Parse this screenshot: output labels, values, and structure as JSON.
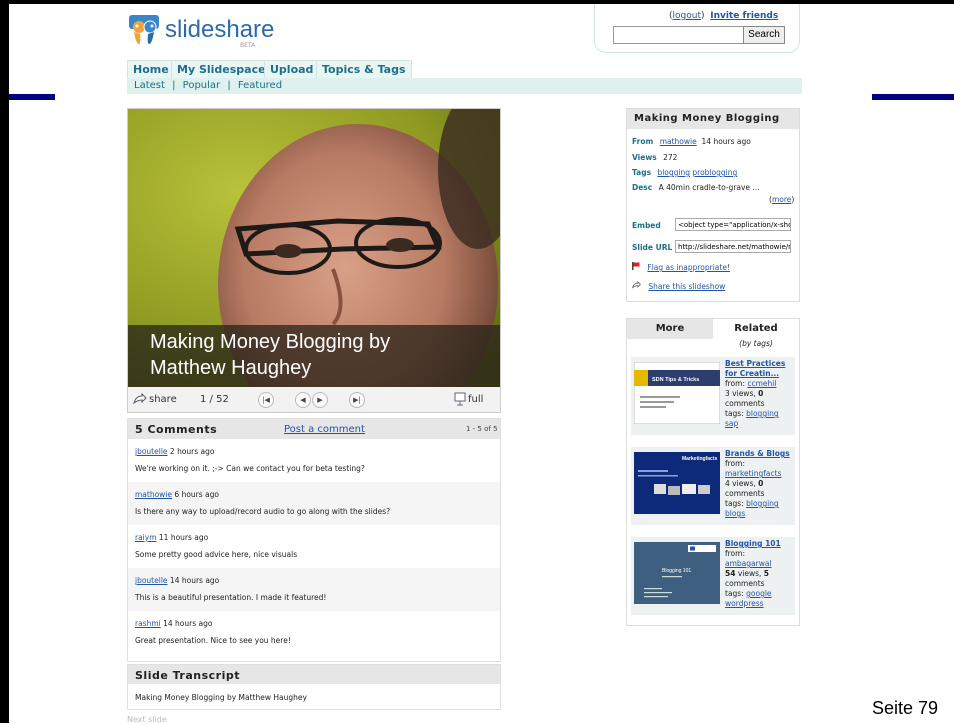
{
  "site": {
    "brand": "slideshare",
    "beta": "BETA",
    "colors": {
      "accent": "#1d6f8a",
      "link": "#2255aa",
      "nav_bg": "#eaf6f4",
      "frame_bar": "#000080"
    }
  },
  "header": {
    "logout": "logout",
    "invite": "Invite friends",
    "search_button": "Search",
    "search_value": ""
  },
  "nav": {
    "tabs": [
      "Home",
      "My Slidespace",
      "Upload",
      "Topics & Tags"
    ],
    "subnav": [
      "Latest",
      "Popular",
      "Featured"
    ]
  },
  "player": {
    "slide_title_line1": "Making Money Blogging by",
    "slide_title_line2": "Matthew Haughey",
    "share": "share",
    "counter": "1 / 52",
    "full": "full",
    "icons": [
      "share-icon",
      "first-slide-icon",
      "prev-slide-icon",
      "next-slide-icon",
      "last-slide-icon",
      "fullscreen-icon"
    ]
  },
  "comments": {
    "title": "5 Comments",
    "post_link": "Post a comment",
    "range": "1 - 5 of 5",
    "items": [
      {
        "user": "jboutelle",
        "time": "2 hours ago",
        "text": "We're working on it. ;-> Can we contact you for beta testing?"
      },
      {
        "user": "mathowie",
        "time": "6 hours ago",
        "text": "Is there any way to upload/record audio to go along with the slides?"
      },
      {
        "user": "raiym",
        "time": "11 hours ago",
        "text": "Some pretty good advice here, nice visuals"
      },
      {
        "user": "jboutelle",
        "time": "14 hours ago",
        "text": "This is a beautiful presentation. I made it featured!"
      },
      {
        "user": "rashmi",
        "time": "14 hours ago",
        "text": "Great presentation. Nice to see you here!"
      }
    ]
  },
  "transcript": {
    "title": "Slide Transcript",
    "text": "Making Money Blogging by Matthew Haughey",
    "next": "Next slide"
  },
  "info": {
    "title": "Making Money Blogging",
    "from_label": "From",
    "from_user": "mathowie",
    "from_time": "14 hours ago",
    "views_label": "Views",
    "views": "272",
    "tags_label": "Tags",
    "tag1": "blogging",
    "tag2": "problogging",
    "desc_label": "Desc",
    "desc": "A 40min cradle-to-grave ...",
    "more": "more",
    "embed_label": "Embed",
    "embed_value": "<object type=\"application/x-shoc",
    "url_label": "Slide URL",
    "url_value": "http://slideshare.net/mathowie/m",
    "flag": "Flag as inappropriate!",
    "share": "Share this slideshow"
  },
  "related": {
    "tab_more": "More",
    "tab_related": "Related",
    "subtitle": "(by tags)",
    "items": [
      {
        "title_l1": "Best Practices",
        "title_l2": "for Creatin...",
        "from_label": "from:",
        "from": "ccmehil",
        "views": "3",
        "views_word": "views,",
        "comments": "0",
        "comments_word": "comments",
        "tags_label": "tags:",
        "tag1": "blogging",
        "tag2": "sap",
        "thumb_title": "SDN Tips & Tricks"
      },
      {
        "title_l1": "Brands & Blogs",
        "title_l2": "",
        "from_label": "from:",
        "from": "marketingfacts",
        "views": "4",
        "views_word": "views,",
        "comments": "0",
        "comments_word": "comments",
        "tags_label": "tags:",
        "tag1": "blogging",
        "tag2": "blogs",
        "thumb_title": "Marketingfacts"
      },
      {
        "title_l1": "Blogging 101",
        "title_l2": "",
        "from_label": "from:",
        "from": "ambagarwal",
        "views": "54",
        "views_word": "views,",
        "comments": "5",
        "comments_word": "comments",
        "tags_label": "tags:",
        "tag1": "google",
        "tag2": "wordpress",
        "thumb_title": "Blogging 101"
      }
    ]
  },
  "page": {
    "number": "Seite 79"
  }
}
